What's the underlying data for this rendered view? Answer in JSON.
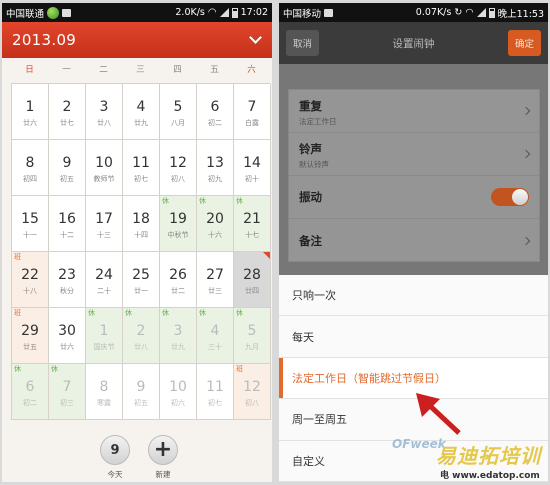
{
  "left": {
    "status": {
      "carrier": "中国联通",
      "speed": "2.0K/s",
      "time": "17:02"
    },
    "header": {
      "month": "2013.09"
    },
    "weekdays": [
      "日",
      "一",
      "二",
      "三",
      "四",
      "五",
      "六"
    ],
    "days": [
      {
        "n": "1",
        "l": "廿六"
      },
      {
        "n": "2",
        "l": "廿七"
      },
      {
        "n": "3",
        "l": "廿八"
      },
      {
        "n": "4",
        "l": "廿九"
      },
      {
        "n": "5",
        "l": "八月"
      },
      {
        "n": "6",
        "l": "初二"
      },
      {
        "n": "7",
        "l": "白露"
      },
      {
        "n": "8",
        "l": "初四"
      },
      {
        "n": "9",
        "l": "初五"
      },
      {
        "n": "10",
        "l": "教师节"
      },
      {
        "n": "11",
        "l": "初七"
      },
      {
        "n": "12",
        "l": "初八"
      },
      {
        "n": "13",
        "l": "初九"
      },
      {
        "n": "14",
        "l": "初十"
      },
      {
        "n": "15",
        "l": "十一"
      },
      {
        "n": "16",
        "l": "十二"
      },
      {
        "n": "17",
        "l": "十三"
      },
      {
        "n": "18",
        "l": "十四"
      },
      {
        "n": "19",
        "l": "中秋节",
        "badge": "休",
        "type": "hol"
      },
      {
        "n": "20",
        "l": "十六",
        "badge": "休",
        "type": "hol"
      },
      {
        "n": "21",
        "l": "十七",
        "badge": "休",
        "type": "hol"
      },
      {
        "n": "22",
        "l": "十八",
        "badge": "班",
        "type": "wkd"
      },
      {
        "n": "23",
        "l": "秋分"
      },
      {
        "n": "24",
        "l": "二十"
      },
      {
        "n": "25",
        "l": "廿一"
      },
      {
        "n": "26",
        "l": "廿二"
      },
      {
        "n": "27",
        "l": "廿三"
      },
      {
        "n": "28",
        "l": "廿四",
        "type": "sel"
      },
      {
        "n": "29",
        "l": "廿五",
        "badge": "班",
        "type": "wkd"
      },
      {
        "n": "30",
        "l": "廿六"
      },
      {
        "n": "1",
        "l": "国庆节",
        "badge": "休",
        "type": "hol",
        "oth": true
      },
      {
        "n": "2",
        "l": "廿八",
        "badge": "休",
        "type": "hol",
        "oth": true
      },
      {
        "n": "3",
        "l": "廿九",
        "badge": "休",
        "type": "hol",
        "oth": true
      },
      {
        "n": "4",
        "l": "三十",
        "badge": "休",
        "type": "hol",
        "oth": true
      },
      {
        "n": "5",
        "l": "九月",
        "badge": "休",
        "type": "hol",
        "oth": true
      },
      {
        "n": "6",
        "l": "初二",
        "badge": "休",
        "type": "hol",
        "oth": true
      },
      {
        "n": "7",
        "l": "初三",
        "badge": "休",
        "type": "hol",
        "oth": true
      },
      {
        "n": "8",
        "l": "寒露",
        "oth": true
      },
      {
        "n": "9",
        "l": "初五",
        "oth": true
      },
      {
        "n": "10",
        "l": "初六",
        "oth": true
      },
      {
        "n": "11",
        "l": "初七",
        "oth": true
      },
      {
        "n": "12",
        "l": "初八",
        "badge": "班",
        "type": "wkd",
        "oth": true
      }
    ],
    "bottom": {
      "today_num": "9",
      "today_label": "今天",
      "new_label": "新建"
    }
  },
  "right": {
    "status": {
      "carrier": "中国移动",
      "speed": "0.07K/s",
      "time": "晚上11:53"
    },
    "actionbar": {
      "cancel": "取消",
      "title": "设置闹钟",
      "ok": "确定"
    },
    "settings": [
      {
        "title": "重复",
        "sub": "法定工作日"
      },
      {
        "title": "铃声",
        "sub": "默认铃声"
      },
      {
        "title": "振动",
        "toggle": true
      },
      {
        "title": "备注"
      }
    ],
    "options": [
      "只响一次",
      "每天",
      "法定工作日（智能跳过节假日）",
      "周一至周五",
      "自定义"
    ],
    "selected_option": 2,
    "watermark": {
      "brand": "OFweek",
      "cn": "易迪拓培训",
      "url": "电 www.edatop.com"
    }
  },
  "colors": {
    "accent_red": "#e0492d",
    "accent_orange": "#e26a2c",
    "holiday_green": "#64b245"
  }
}
